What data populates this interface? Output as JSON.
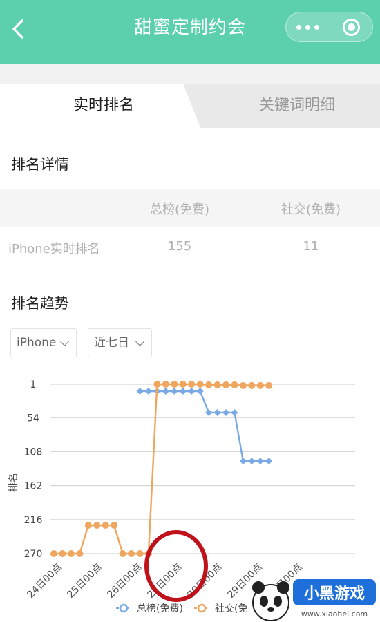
{
  "header": {
    "title": "甜蜜定制约会",
    "back_icon": "chevron-left-icon",
    "menu_icon": "more-dots-icon",
    "close_icon": "record-circle-icon",
    "bg_color": "#5ccfac"
  },
  "tabs": [
    {
      "label": "实时排名",
      "active": true
    },
    {
      "label": "关键词明细",
      "active": false
    }
  ],
  "rank_detail": {
    "title": "排名详情",
    "columns": [
      "总榜(免费)",
      "社交(免费)"
    ],
    "rows": [
      {
        "label": "iPhone实时排名",
        "values": [
          "155",
          "11"
        ]
      }
    ]
  },
  "trend": {
    "title": "排名趋势",
    "device_select": "iPhone",
    "range_select": "近七日"
  },
  "chart_data": {
    "type": "line",
    "ylabel": "排名",
    "y_ticks": [
      "1",
      "54",
      "108",
      "162",
      "216",
      "270"
    ],
    "ylim": [
      1,
      270
    ],
    "y_inverted": true,
    "x_ticks": [
      "24日00点",
      "25日00点",
      "26日00点",
      "27日00点",
      "28日00点",
      "29日00点",
      "30日00点"
    ],
    "x_index_range": [
      0,
      20
    ],
    "series": [
      {
        "name": "总榜(免费)",
        "color": "#7aaae6",
        "marker": "diamond",
        "points": [
          [
            10,
            12
          ],
          [
            11,
            12
          ],
          [
            12,
            12
          ],
          [
            13,
            12
          ],
          [
            14,
            12
          ],
          [
            15,
            12
          ],
          [
            16,
            12
          ],
          [
            17,
            12
          ],
          [
            18,
            46
          ],
          [
            19,
            46
          ],
          [
            20,
            46
          ],
          [
            21,
            46
          ],
          [
            22,
            123
          ],
          [
            23,
            123
          ],
          [
            24,
            123
          ],
          [
            25,
            123
          ]
        ]
      },
      {
        "name": "社交(免费)",
        "color": "#efa65f",
        "marker": "circle",
        "points": [
          [
            0,
            270
          ],
          [
            1,
            270
          ],
          [
            2,
            270
          ],
          [
            3,
            270
          ],
          [
            4,
            225
          ],
          [
            5,
            225
          ],
          [
            6,
            225
          ],
          [
            7,
            225
          ],
          [
            8,
            270
          ],
          [
            9,
            270
          ],
          [
            10,
            270
          ],
          [
            11,
            270
          ],
          [
            12,
            1
          ],
          [
            13,
            1
          ],
          [
            14,
            1
          ],
          [
            15,
            1
          ],
          [
            16,
            1
          ],
          [
            17,
            1
          ],
          [
            18,
            2
          ],
          [
            19,
            2
          ],
          [
            20,
            2
          ],
          [
            21,
            2
          ],
          [
            22,
            3
          ],
          [
            23,
            3
          ],
          [
            24,
            3
          ],
          [
            25,
            3
          ]
        ]
      }
    ],
    "legend": [
      {
        "label": "总榜(免费)",
        "color": "#7aaae6"
      },
      {
        "label": "社交(免",
        "color": "#efa65f"
      }
    ],
    "legend_position": "bottom",
    "grid": true
  },
  "annotation": {
    "color": "#c0121b"
  },
  "watermark": {
    "text": "小黑游戏",
    "url": "www.xiaohei.com"
  }
}
